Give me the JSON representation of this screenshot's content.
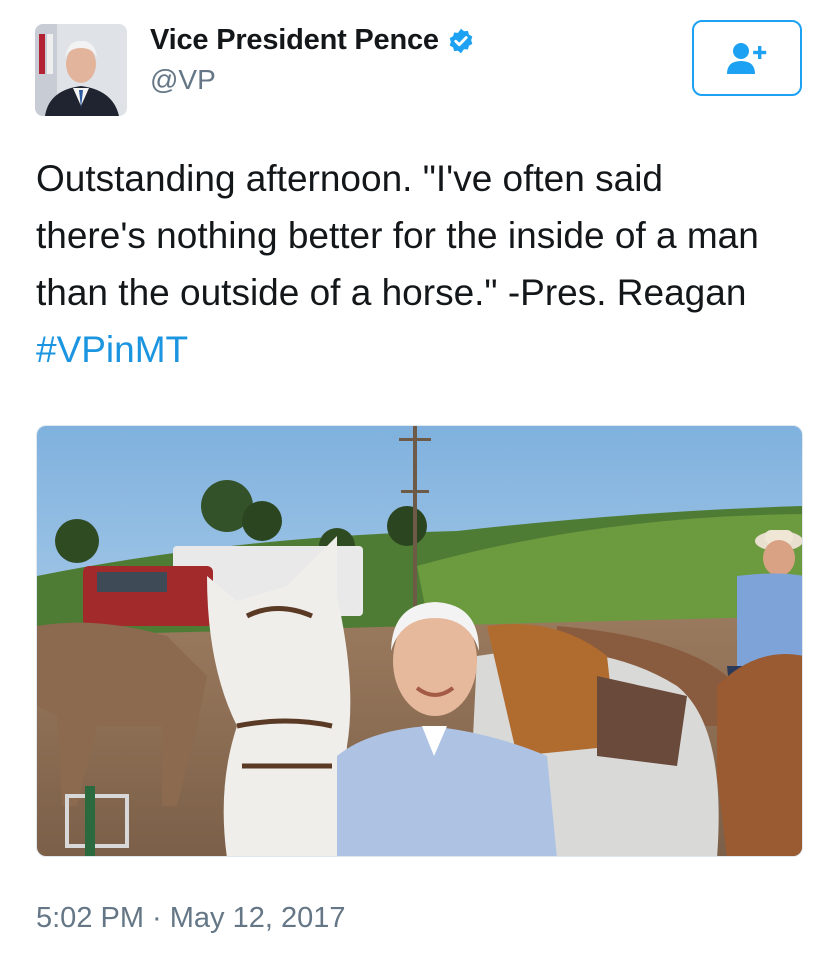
{
  "tweet": {
    "author": {
      "display_name": "Vice President Pence",
      "handle": "@VP",
      "verified": true,
      "avatar_icon": "profile-photo"
    },
    "follow_button": {
      "icon": "follow-user-plus-icon",
      "color": "#1da1f2"
    },
    "text_lines": [
      "Outstanding afternoon. \"I've often said",
      "there's nothing better for the inside of a man",
      "than the outside of a horse.\" -Pres. Reagan"
    ],
    "hashtag": "#VPinMT",
    "media": {
      "type": "photo",
      "subject": "man in blue shirt standing beside white horse, riders and trailer in hills"
    },
    "timestamp": "5:02 PM · May 12, 2017"
  },
  "colors": {
    "link": "#1b95e0",
    "verified": "#1da1f2",
    "meta": "#657786"
  }
}
